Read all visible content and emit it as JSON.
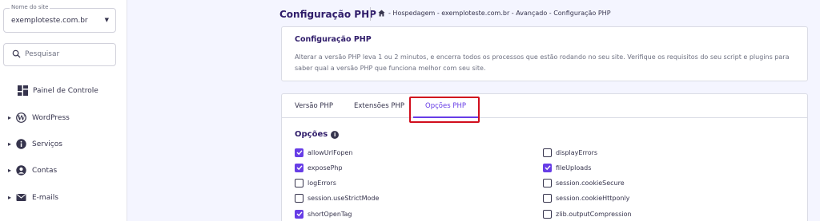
{
  "sidebar": {
    "site_select": {
      "label": "Nome do site",
      "value": "exemploteste.com.br"
    },
    "search": {
      "placeholder": "Pesquisar"
    },
    "items": [
      {
        "label": "Painel de Controle",
        "icon": "dashboard-icon"
      },
      {
        "label": "WordPress",
        "icon": "wordpress-icon"
      },
      {
        "label": "Serviços",
        "icon": "info-icon"
      },
      {
        "label": "Contas",
        "icon": "user-icon"
      },
      {
        "label": "E-mails",
        "icon": "mail-icon"
      }
    ]
  },
  "header": {
    "title": "Configuração PHP",
    "breadcrumb": "- Hospedagem - exemploteste.com.br - Avançado - Configuração PHP"
  },
  "info_card": {
    "title": "Configuração PHP",
    "description": "Alterar a versão PHP leva 1 ou 2 minutos, e encerra todos os processos que estão rodando no seu site. Verifique os requisitos do seu script e plugins para saber qual a versão PHP que funciona melhor com seu site."
  },
  "tabs": [
    {
      "label": "Versão PHP",
      "active": false
    },
    {
      "label": "Extensões PHP",
      "active": false
    },
    {
      "label": "Opções PHP",
      "active": true
    }
  ],
  "options": {
    "title": "Opções",
    "left": [
      {
        "label": "allowUrlFopen",
        "checked": true
      },
      {
        "label": "exposePhp",
        "checked": true
      },
      {
        "label": "logErrors",
        "checked": false
      },
      {
        "label": "session.useStrictMode",
        "checked": false
      },
      {
        "label": "shortOpenTag",
        "checked": true
      }
    ],
    "right": [
      {
        "label": "displayErrors",
        "checked": false
      },
      {
        "label": "fileUploads",
        "checked": true
      },
      {
        "label": "session.cookieSecure",
        "checked": false
      },
      {
        "label": "session.cookieHttponly",
        "checked": false
      },
      {
        "label": "zlib.outputCompression",
        "checked": false
      }
    ]
  },
  "colors": {
    "accent": "#673de6",
    "highlight": "#d10e1d",
    "title": "#2f1c6a"
  }
}
